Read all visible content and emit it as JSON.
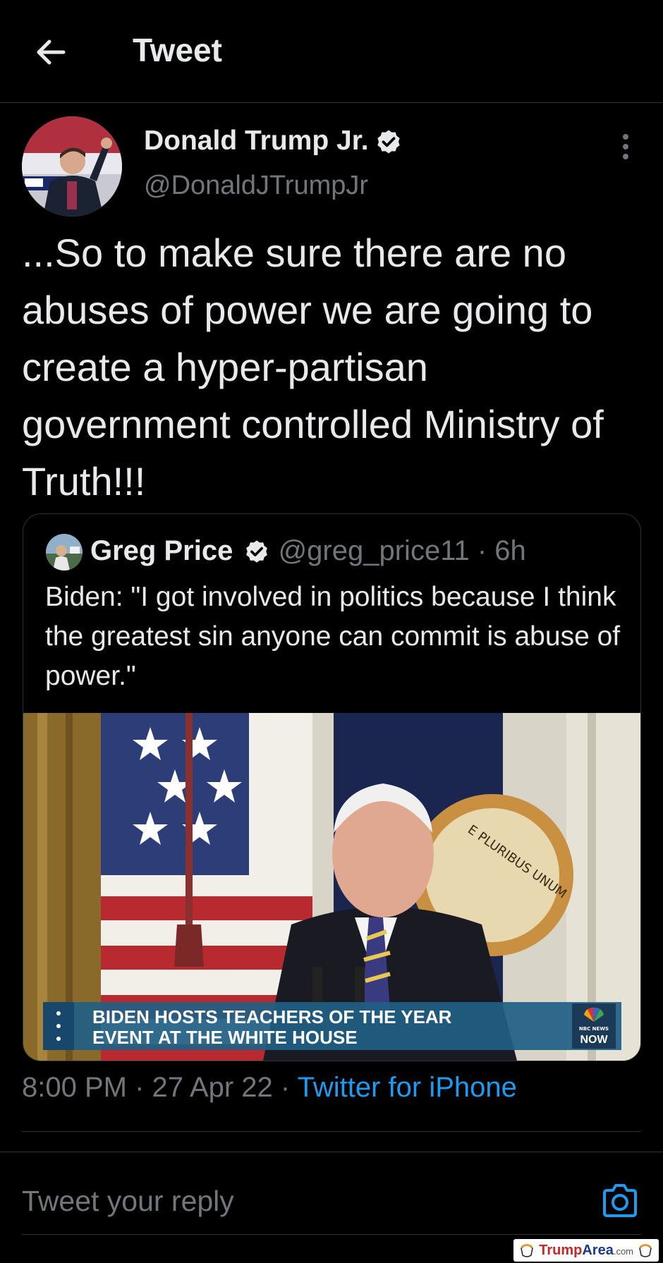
{
  "header": {
    "title": "Tweet"
  },
  "tweet": {
    "author_name": "Donald Trump Jr.",
    "handle": "@DonaldJTrumpJr",
    "text": "...So to make sure there are no abuses of power we are going to create a hyper-partisan government controlled Ministry of Truth!!!",
    "time": "8:00 PM",
    "date": "27 Apr 22",
    "source": "Twitter for iPhone"
  },
  "quoted": {
    "author_name": "Greg Price",
    "handle": "@greg_price11",
    "age": "6h",
    "text": "Biden: \"I got involved in politics because I think the greatest sin anyone can commit is abuse of power.\"",
    "chyron_line1": "BIDEN HOSTS TEACHERS OF THE YEAR",
    "chyron_line2": "EVENT AT THE WHITE HOUSE",
    "seal_text": "E PLURIBUS UNUM",
    "network_label_small": "NBC NEWS",
    "network_label": "NOW"
  },
  "reply": {
    "placeholder": "Tweet your reply"
  },
  "watermark": {
    "brand_part1": "Trump",
    "brand_part2": "Area",
    "suffix": ".com"
  },
  "colors": {
    "background": "#000000",
    "text": "#e7e9ea",
    "muted": "#71767b",
    "link": "#1d9bf0",
    "border": "#2f3336"
  },
  "icons": {
    "back": "arrow-left-icon",
    "verified": "verified-badge-icon",
    "more": "more-vertical-icon",
    "camera": "camera-icon"
  }
}
